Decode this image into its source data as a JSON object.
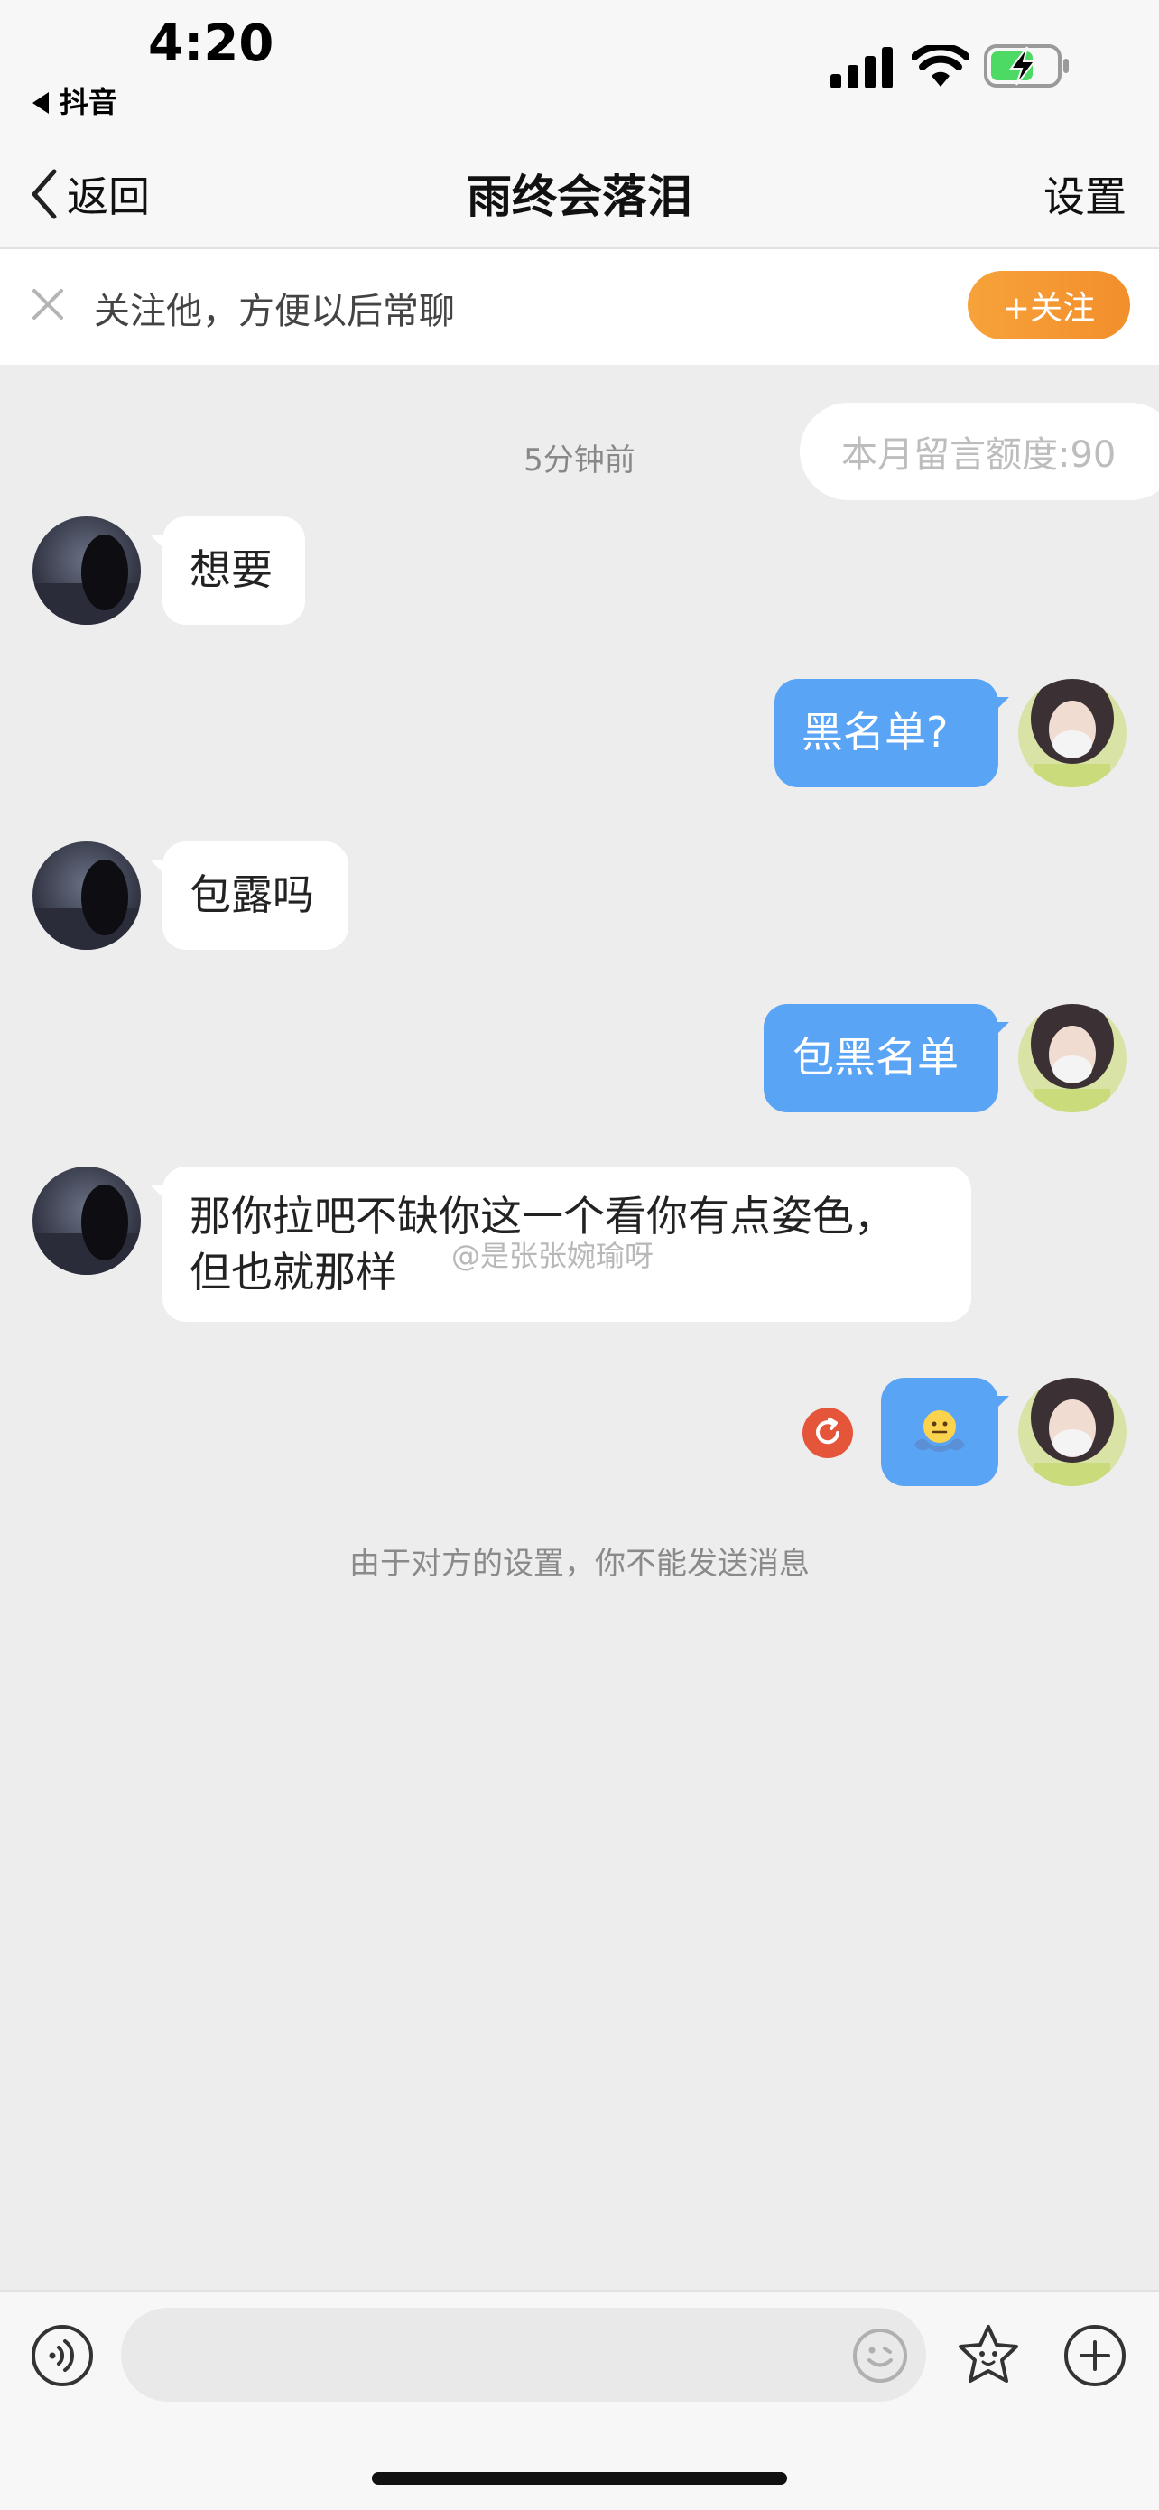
{
  "status_bar": {
    "time": "4:20",
    "back_app_label": "抖音"
  },
  "nav": {
    "back_label": "返回",
    "title": "雨终会落泪",
    "settings_label": "设置"
  },
  "follow_banner": {
    "text": "关注他，方便以后常聊",
    "button_label": "+关注"
  },
  "chat": {
    "quota_label": "本月留言额度:90",
    "timestamp": "5分钟前",
    "messages": [
      {
        "side": "incoming",
        "text": "想要"
      },
      {
        "side": "outgoing",
        "text": "黑名单?"
      },
      {
        "side": "incoming",
        "text": "包露吗"
      },
      {
        "side": "outgoing",
        "text": "包黑名单"
      },
      {
        "side": "incoming",
        "text": "那你拉吧不缺你这一个看你有点姿色，\n但也就那样"
      },
      {
        "side": "outgoing",
        "text": "",
        "content": "shrug-emoji-sticker",
        "status": "send-failed-retry-icon"
      }
    ],
    "watermark": "@是张张婉瑜呀",
    "notice": "由于对方的设置，你不能发送消息"
  },
  "input_bar": {
    "voice_icon": "voice-icon",
    "emoji_icon": "smiley-icon",
    "sticker_icon": "star-face-icon",
    "plus_icon": "plus-icon"
  },
  "colors": {
    "outgoing_bubble": "#5aa4f5",
    "follow_button": "#f39a31",
    "retry_badge": "#e4553a"
  }
}
